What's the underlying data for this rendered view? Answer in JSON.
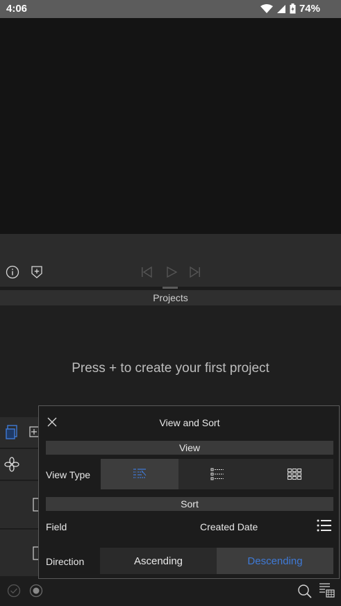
{
  "status": {
    "time": "4:06",
    "battery": "74%"
  },
  "projects": {
    "header": "Projects",
    "empty_message": "Press + to create your first project"
  },
  "dialog": {
    "title": "View and Sort",
    "view_section": "View",
    "view_type_label": "View Type",
    "view_type_selected": "list-timeline",
    "sort_section": "Sort",
    "field_label": "Field",
    "field_value": "Created Date",
    "direction_label": "Direction",
    "direction_options": [
      "Ascending",
      "Descending"
    ],
    "direction_selected": "Descending"
  },
  "colors": {
    "accent": "#3f7ad6",
    "status_bar": "#5c5c5c"
  }
}
